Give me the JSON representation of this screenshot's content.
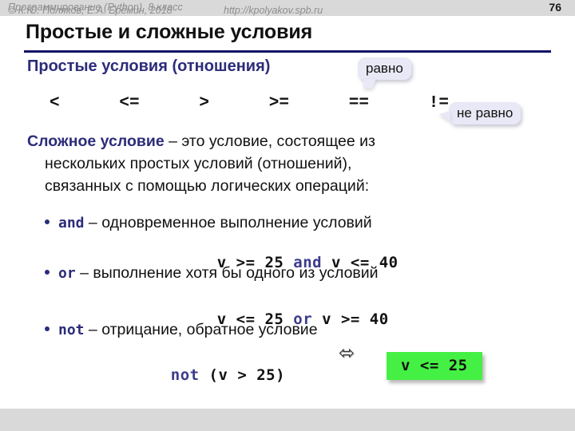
{
  "header": {
    "course_title": "Программирование (Python), 8 класс",
    "page_number": "76"
  },
  "title": "Простые и сложные условия",
  "subtitle": "Простые условия (отношения)",
  "operators": [
    "<",
    "<=",
    ">",
    ">=",
    "==",
    "!="
  ],
  "callouts": [
    {
      "name": "равно-callout",
      "label": "равно"
    },
    {
      "name": "не-равно-callout",
      "label": "не равно"
    }
  ],
  "definition": {
    "term": "Сложное условие",
    "line1_rest": " – это условие, состоящее из",
    "line2": "нескольких простых условий (отношений),",
    "line3": "связанных с помощью логических операций:"
  },
  "bullets": [
    {
      "keyword": "and",
      "description": " – одновременное выполнение условий",
      "code_prefix": "v >= 25 ",
      "code_keyword": "and",
      "code_suffix": " v <= 40"
    },
    {
      "keyword": "or",
      "description": " – выполнение хотя бы одного из условий",
      "code_prefix": "v <= 25 ",
      "code_keyword": "or",
      "code_suffix": " v >= 40"
    },
    {
      "keyword": "not",
      "description": " – отрицание, обратное условие",
      "code_prefix": "",
      "code_keyword": "not",
      "code_suffix": " (v > 25)"
    }
  ],
  "equivalence_arrow": "⬄",
  "result_box": "v <= 25",
  "footer": {
    "copyright": "© К.Ю. Поляков, Е.А. Ерёмин, 2018",
    "url": "http://kpolyakov.spb.ru"
  },
  "colors": {
    "accent_navy": "#2c2c7a",
    "header_gray": "#d9d9d9",
    "result_green": "#44f044",
    "callout_lavender": "#e8e8f6"
  }
}
